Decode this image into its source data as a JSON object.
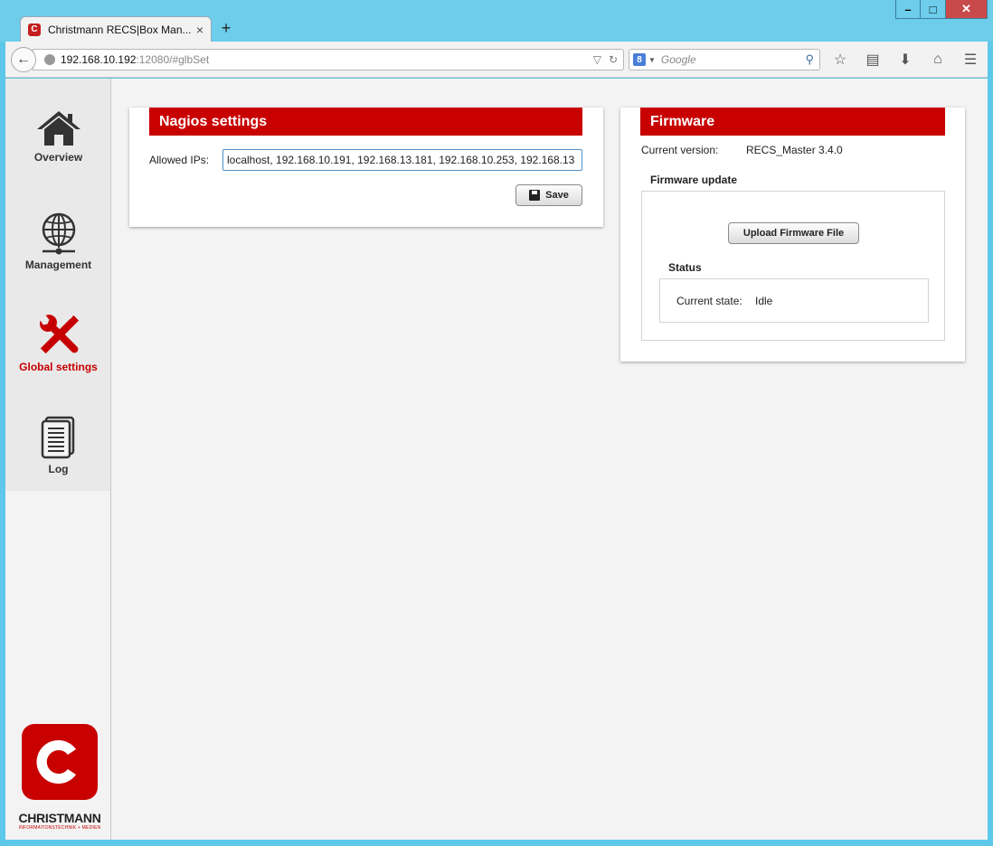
{
  "browser": {
    "tab_title": "Christmann RECS|Box Man...",
    "tab_favicon": "C",
    "url_host": "192.168.10.192",
    "url_rest": ":12080/#glbSet",
    "search_placeholder": "Google",
    "search_engine_icon": "8"
  },
  "sidebar": {
    "items": [
      {
        "label": "Overview",
        "icon": "home-icon"
      },
      {
        "label": "Management",
        "icon": "globe-network-icon"
      },
      {
        "label": "Global settings",
        "icon": "tools-icon",
        "active": true
      },
      {
        "label": "Log",
        "icon": "document-icon"
      }
    ],
    "logo_text": "CHRISTMANN",
    "logo_sub": "INFORMATIONSTECHNIK + MEDIEN"
  },
  "nagios": {
    "title": "Nagios settings",
    "allowed_ips_label": "Allowed IPs:",
    "allowed_ips_value": "localhost, 192.168.10.191, 192.168.13.181, 192.168.10.253, 192.168.13",
    "save_label": "Save"
  },
  "firmware": {
    "title": "Firmware",
    "current_version_label": "Current version:",
    "current_version_value": "RECS_Master 3.4.0",
    "update_legend": "Firmware update",
    "upload_label": "Upload Firmware File",
    "status_legend": "Status",
    "current_state_label": "Current state:",
    "current_state_value": "Idle"
  },
  "colors": {
    "accent": "#c90000",
    "titlebar": "#6dcdeb"
  }
}
